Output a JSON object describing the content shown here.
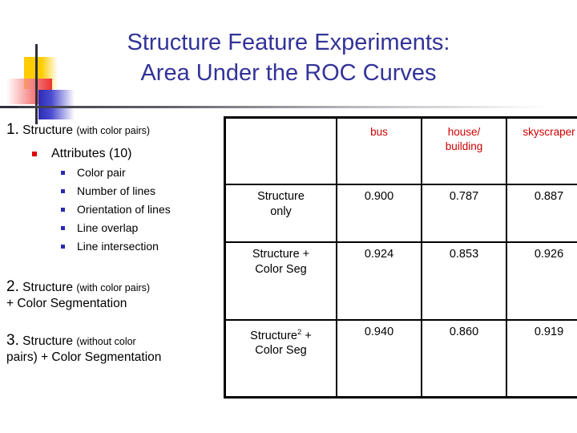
{
  "slide": {
    "title_line1": "Structure Feature Experiments:",
    "title_line2": "Area Under the ROC Curves",
    "title_color": "#333399"
  },
  "outline": {
    "item1": {
      "number": "1.",
      "main": "Structure",
      "paren": "(with color pairs)",
      "sub": {
        "label": "Attributes (10)",
        "items": [
          "Color pair",
          "Number of lines",
          "Orientation of lines",
          "Line overlap",
          "Line intersection"
        ]
      }
    },
    "item2": {
      "number": "2.",
      "main": "Structure",
      "paren": "(with color pairs)",
      "cont": "+ Color Segmentation"
    },
    "item3": {
      "number": "3.",
      "main": "Structure",
      "paren": "(without color",
      "cont": "pairs) + Color Segmentation"
    },
    "bullet_color_level2": "#dd0000",
    "bullet_color_level3": "#2a2ab0"
  },
  "table": {
    "header_color": "#cc0000",
    "corner": "",
    "columns": [
      "bus",
      "house/ building",
      "skyscraper"
    ],
    "col_house_line1": "house/",
    "col_house_line2": "building",
    "rows": [
      {
        "label_line1": "Structure",
        "label_line2": "only",
        "label_sup": "",
        "bus": "0.900",
        "house_building": "0.787",
        "skyscraper": "0.887"
      },
      {
        "label_line1": "Structure +",
        "label_line2": "Color Seg",
        "label_sup": "",
        "bus": "0.924",
        "house_building": "0.853",
        "skyscraper": "0.926"
      },
      {
        "label_line1": "Structure",
        "label_line1b": " +",
        "label_line2": "Color Seg",
        "label_sup": "2",
        "bus": "0.940",
        "house_building": "0.860",
        "skyscraper": "0.919"
      }
    ]
  }
}
